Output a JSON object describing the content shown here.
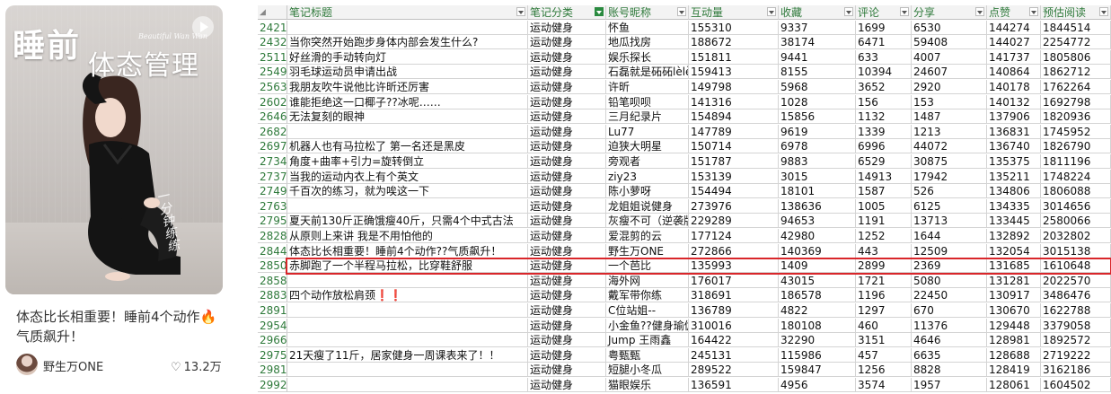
{
  "card": {
    "cover_title_line1": "睡前",
    "cover_title_line2": "体态管理",
    "cover_script_small": "Beautiful Wan Wan",
    "cover_script_side": "一分钟练练",
    "title": "体态比长相重要！睡前4个动作🔥气质飙升！",
    "author": "野生万ONE",
    "likes": "13.2万"
  },
  "sheet": {
    "corner": "",
    "columns": [
      "笔记标题",
      "笔记分类",
      "账号昵称",
      "互动量",
      "收藏",
      "评论",
      "分享",
      "点赞",
      "预估阅读"
    ],
    "highlight_row_index": 16,
    "rows": [
      {
        "rn": "2421",
        "title": "",
        "cat": "运动健身",
        "nick": "怀鱼",
        "inter": "155310",
        "fav": "9337",
        "cmt": "1699",
        "share": "6530",
        "like": "144274",
        "read": "1844514"
      },
      {
        "rn": "2432",
        "title": "当你突然开始跑步身体内部会发生什么?",
        "cat": "运动健身",
        "nick": "地瓜找房",
        "inter": "188672",
        "fav": "38174",
        "cmt": "6471",
        "share": "59408",
        "like": "144027",
        "read": "2254772"
      },
      {
        "rn": "2511",
        "title": "好丝滑的手动转向灯",
        "cat": "运动健身",
        "nick": "娱乐探长",
        "inter": "151811",
        "fav": "9441",
        "cmt": "633",
        "share": "4007",
        "like": "141737",
        "read": "1805806"
      },
      {
        "rn": "2549",
        "title": "羽毛球运动员申请出战",
        "cat": "运动健身",
        "nick": "石磊就是砳砳lèlè",
        "inter": "159413",
        "fav": "8155",
        "cmt": "10394",
        "share": "24607",
        "like": "140864",
        "read": "1862712"
      },
      {
        "rn": "2563",
        "title": "我朋友吹牛说他比许昕还厉害",
        "cat": "运动健身",
        "nick": "许昕",
        "inter": "149798",
        "fav": "5968",
        "cmt": "3652",
        "share": "2920",
        "like": "140178",
        "read": "1762264"
      },
      {
        "rn": "2602",
        "title": "谁能拒绝这一口椰子??冰呢……",
        "cat": "运动健身",
        "nick": "铅笔呗呗",
        "inter": "141316",
        "fav": "1028",
        "cmt": "156",
        "share": "153",
        "like": "140132",
        "read": "1692798"
      },
      {
        "rn": "2646",
        "title": "无法复刻的眼神",
        "cat": "运动健身",
        "nick": "三月纪录片",
        "inter": "154894",
        "fav": "15856",
        "cmt": "1132",
        "share": "1487",
        "like": "137906",
        "read": "1820936"
      },
      {
        "rn": "2682",
        "title": "",
        "cat": "运动健身",
        "nick": "Lu77",
        "inter": "147789",
        "fav": "9619",
        "cmt": "1339",
        "share": "1213",
        "like": "136831",
        "read": "1745952"
      },
      {
        "rn": "2697",
        "title": "机器人也有马拉松了 第一名还是黑皮",
        "cat": "运动健身",
        "nick": "迫狭大明星",
        "inter": "150714",
        "fav": "6978",
        "cmt": "6996",
        "share": "44072",
        "like": "136740",
        "read": "1826790"
      },
      {
        "rn": "2734",
        "title": "角度+曲率+引力=旋转倒立",
        "cat": "运动健身",
        "nick": "旁观者",
        "inter": "151787",
        "fav": "9883",
        "cmt": "6529",
        "share": "30875",
        "like": "135375",
        "read": "1811196"
      },
      {
        "rn": "2737",
        "title": "当我的运动内衣上有个英文",
        "cat": "运动健身",
        "nick": "ziy23",
        "inter": "153139",
        "fav": "3015",
        "cmt": "14913",
        "share": "17942",
        "like": "135211",
        "read": "1748224"
      },
      {
        "rn": "2749",
        "title": "千百次的练习，就为唉这一下",
        "cat": "运动健身",
        "nick": "陈小萝呀",
        "inter": "154494",
        "fav": "18101",
        "cmt": "1587",
        "share": "526",
        "like": "134806",
        "read": "1806088"
      },
      {
        "rn": "2763",
        "title": "",
        "cat": "运动健身",
        "nick": "龙姐姐说健身",
        "inter": "273976",
        "fav": "138636",
        "cmt": "1005",
        "share": "6125",
        "like": "134335",
        "read": "3014656"
      },
      {
        "rn": "2795",
        "title": "夏天前130斤正确饿瘦40斤，只需4个中式古法",
        "cat": "运动健身",
        "nick": "灰瘦不可（逆袭版）",
        "inter": "229289",
        "fav": "94653",
        "cmt": "1191",
        "share": "13713",
        "like": "133445",
        "read": "2580066"
      },
      {
        "rn": "2828",
        "title": "从原则上来讲 我是不用怕他的",
        "cat": "运动健身",
        "nick": "爱混剪的云",
        "inter": "177124",
        "fav": "42980",
        "cmt": "1252",
        "share": "1644",
        "like": "132892",
        "read": "2032802"
      },
      {
        "rn": "2844",
        "title": "体态比长相重要！睡前4个动作??气质飙升！",
        "cat": "运动健身",
        "nick": "野生万ONE",
        "inter": "272866",
        "fav": "140369",
        "cmt": "443",
        "share": "12509",
        "like": "132054",
        "read": "3015138"
      },
      {
        "rn": "2850",
        "title": "赤脚跑了一个半程马拉松，比穿鞋舒服",
        "cat": "运动健身",
        "nick": "一个芭比",
        "inter": "135993",
        "fav": "1409",
        "cmt": "2899",
        "share": "2369",
        "like": "131685",
        "read": "1610648"
      },
      {
        "rn": "2858",
        "title": "",
        "cat": "运动健身",
        "nick": "海外网",
        "inter": "176017",
        "fav": "43015",
        "cmt": "1721",
        "share": "5080",
        "like": "131281",
        "read": "2022570"
      },
      {
        "rn": "2883",
        "title": "四个动作放松肩颈❗❗",
        "cat": "运动健身",
        "nick": "戴军带你练",
        "inter": "318691",
        "fav": "186578",
        "cmt": "1196",
        "share": "22450",
        "like": "130917",
        "read": "3486476"
      },
      {
        "rn": "2891",
        "title": "",
        "cat": "运动健身",
        "nick": "C位站姐--",
        "inter": "136789",
        "fav": "4822",
        "cmt": "1297",
        "share": "670",
        "like": "130670",
        "read": "1622788"
      },
      {
        "rn": "2954",
        "title": "",
        "cat": "运动健身",
        "nick": "小金鱼??健身瑜伽",
        "inter": "310016",
        "fav": "180108",
        "cmt": "460",
        "share": "11376",
        "like": "129448",
        "read": "3379058"
      },
      {
        "rn": "2966",
        "title": "",
        "cat": "运动健身",
        "nick": "Jump 王雨鑫",
        "inter": "164422",
        "fav": "32290",
        "cmt": "3151",
        "share": "4646",
        "like": "128981",
        "read": "1892572"
      },
      {
        "rn": "2975",
        "title": "21天瘦了11斤，居家健身一周课表来了！！",
        "cat": "运动健身",
        "nick": "粤甄甄",
        "inter": "245131",
        "fav": "115986",
        "cmt": "457",
        "share": "6635",
        "like": "128688",
        "read": "2719222"
      },
      {
        "rn": "2981",
        "title": "",
        "cat": "运动健身",
        "nick": "短腿小冬瓜",
        "inter": "289522",
        "fav": "159847",
        "cmt": "1256",
        "share": "8828",
        "like": "128419",
        "read": "3162186"
      },
      {
        "rn": "2992",
        "title": "",
        "cat": "运动健身",
        "nick": "猫眼娱乐",
        "inter": "136591",
        "fav": "4956",
        "cmt": "3574",
        "share": "1957",
        "like": "128061",
        "read": "1604502"
      }
    ]
  }
}
